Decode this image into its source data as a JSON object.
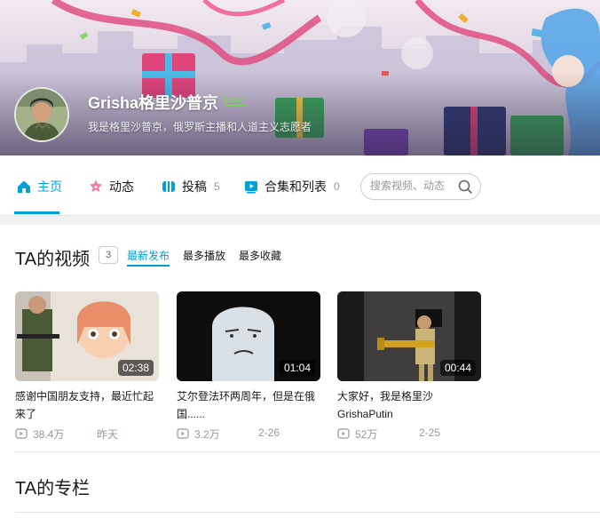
{
  "profile": {
    "username": "Grisha格里沙普京",
    "level": "LV2",
    "sign": "我是格里沙普京，俄罗斯主播和人道主义志愿者"
  },
  "nav": {
    "items": [
      {
        "label": "主页",
        "count": "",
        "icon": "home-icon"
      },
      {
        "label": "动态",
        "count": "",
        "icon": "dynamic-icon"
      },
      {
        "label": "投稿",
        "count": "5",
        "icon": "upload-icon"
      },
      {
        "label": "合集和列表",
        "count": "0",
        "icon": "collection-icon"
      }
    ],
    "search_placeholder": "搜索视频、动态"
  },
  "videos": {
    "title": "TA的视频",
    "count": "3",
    "sort_options": [
      "最新发布",
      "最多播放",
      "最多收藏"
    ],
    "list": [
      {
        "title": "感谢中国朋友支持，最近忙起来了",
        "duration": "02:38",
        "views": "38.4万",
        "date": "昨天"
      },
      {
        "title": "艾尔登法环两周年，但是在俄国......",
        "duration": "01:04",
        "views": "3.2万",
        "date": "2-26"
      },
      {
        "title": "大家好，我是格里沙GrishaPutin",
        "duration": "00:44",
        "views": "52万",
        "date": "2-25"
      }
    ]
  },
  "column": {
    "title": "TA的专栏"
  },
  "colors": {
    "accent": "#00a1d6",
    "text": "#18191c",
    "muted": "#9499a0"
  }
}
